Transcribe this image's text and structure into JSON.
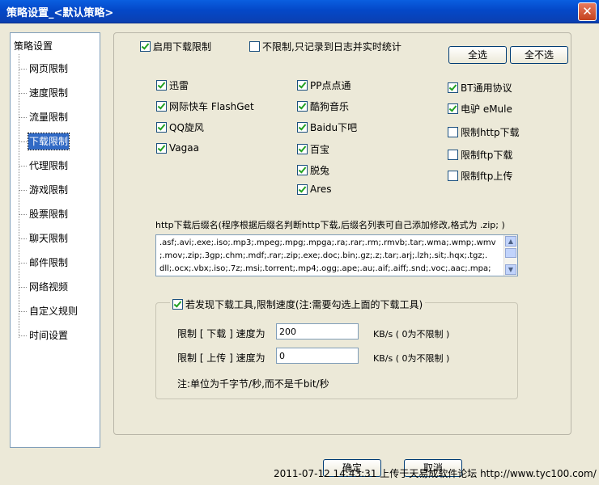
{
  "window": {
    "title": "策略设置_<默认策略>",
    "close_label": "✕"
  },
  "nav": {
    "root": "策略设置",
    "items": [
      "网页限制",
      "速度限制",
      "流量限制",
      "下载限制",
      "代理限制",
      "游戏限制",
      "股票限制",
      "聊天限制",
      "邮件限制",
      "网络视频",
      "自定义规则",
      "时间设置"
    ],
    "selected": "下载限制"
  },
  "download": {
    "enable_label": "启用下载限制",
    "no_limit_label": "不限制,只记录到日志并实时统计",
    "select_all": "全选",
    "select_none": "全不选",
    "tools": [
      {
        "label": "迅雷",
        "checked": true
      },
      {
        "label": "网际快车 FlashGet",
        "checked": true
      },
      {
        "label": "QQ旋风",
        "checked": true
      },
      {
        "label": "Vagaa",
        "checked": true
      },
      {
        "label": "PP点点通",
        "checked": true
      },
      {
        "label": "酷狗音乐",
        "checked": true
      },
      {
        "label": "Baidu下吧",
        "checked": true
      },
      {
        "label": "百宝",
        "checked": true
      },
      {
        "label": "脱兔",
        "checked": true
      },
      {
        "label": "Ares",
        "checked": true
      },
      {
        "label": "BT通用协议",
        "checked": true
      },
      {
        "label": "电驴 eMule",
        "checked": true
      },
      {
        "label": "限制http下载",
        "checked": false
      },
      {
        "label": "限制ftp下载",
        "checked": false
      },
      {
        "label": "限制ftp上传",
        "checked": false
      }
    ],
    "ext_label": "http下载后缀名(程序根据后缀名判断http下载,后缀名列表可自己添加修改,格式为 .zip; )",
    "ext_text": ".asf;.avi;.exe;.iso;.mp3;.mpeg;.mpg;.mpga;.ra;.rar;.rm;.rmvb;.tar;.wma;.wmp;.wmv\n;.mov;.zip;.3gp;.chm;.mdf;.rar;.zip;.exe;.doc;.bin;.gz;.z;.tar;.arj;.lzh;.sit;.hqx;.tgz;.\ndll;.ocx;.vbx;.iso;.7z;.msi;.torrent;.mp4;.ogg;.ape;.au;.aif;.aiff;.snd;.voc;.aac;.mpa;",
    "speed_group_label": "若发现下载工具,限制速度(注:需要勾选上面的下载工具)",
    "down_label": "限制 [ 下载 ] 速度为",
    "down_value": "200",
    "down_unit": "KB/s ( 0为不限制 )",
    "up_label": "限制 [ 上传 ] 速度为",
    "up_value": "0",
    "up_unit": "KB/s ( 0为不限制 )",
    "note": "注:单位为千字节/秒,而不是千bit/秒"
  },
  "footer": {
    "ok": "确定",
    "cancel": "取消"
  },
  "watermark": "2011-07-12 14:43:31 上传于天易成软件论坛 http://www.tyc100.com/"
}
